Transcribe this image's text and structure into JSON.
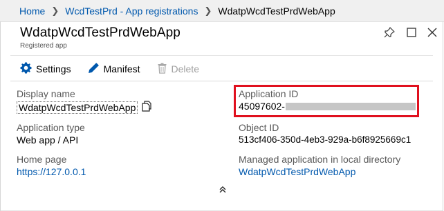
{
  "breadcrumb": {
    "home": "Home",
    "parent": "WcdTestPrd - App registrations",
    "current": "WdatpWcdTestPrdWebApp"
  },
  "blade": {
    "title": "WdatpWcdTestPrdWebApp",
    "subtitle": "Registered app",
    "controls": [
      "pin-icon",
      "maximize-icon",
      "close-icon"
    ]
  },
  "toolbar": {
    "settings_label": "Settings",
    "manifest_label": "Manifest",
    "delete_label": "Delete"
  },
  "essentials": {
    "display_name": {
      "label": "Display name",
      "value": "WdatpWcdTestPrdWebApp"
    },
    "application_type": {
      "label": "Application type",
      "value": "Web app / API"
    },
    "home_page": {
      "label": "Home page",
      "value": "https://127.0.0.1"
    },
    "application_id": {
      "label": "Application ID",
      "value": "45097602-"
    },
    "object_id": {
      "label": "Object ID",
      "value": "513cf406-350d-4eb3-929a-b6f8925669c1"
    },
    "managed_app": {
      "label": "Managed application in local directory",
      "value": "WdatpWcdTestPrdWebApp"
    }
  },
  "colors": {
    "link": "#0058ad",
    "highlight": "#e0101e",
    "redaction": "#c6c6c6"
  }
}
